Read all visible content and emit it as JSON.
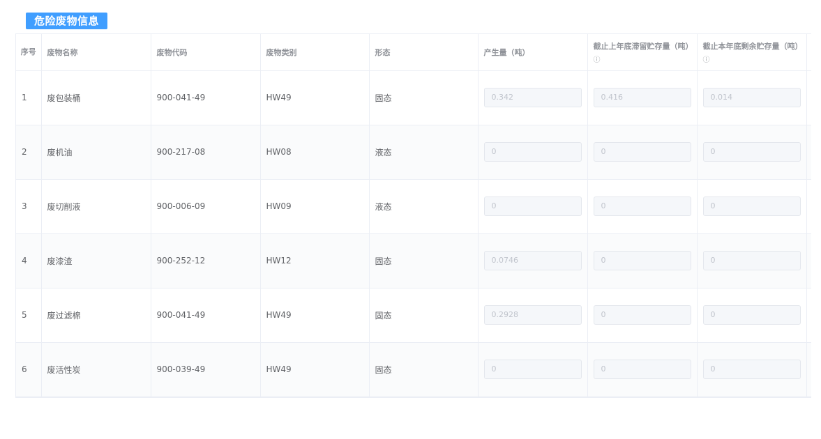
{
  "section": {
    "title": "危险废物信息"
  },
  "table": {
    "headers": {
      "no": "序号",
      "name": "废物名称",
      "code": "废物代码",
      "category": "废物类别",
      "form": "形态",
      "amount": "产生量（吨）",
      "prev_stock": "截止上年底滞留贮存量（吨）",
      "remain_stock": "截止本年底剩余贮存量（吨）",
      "info_icon": "ⓘ"
    },
    "rows": [
      {
        "no": "1",
        "name": "废包装桶",
        "code": "900-041-49",
        "category": "HW49",
        "form": "固态",
        "amount": "0.342",
        "prev_stock": "0.416",
        "remain_stock": "0.014"
      },
      {
        "no": "2",
        "name": "废机油",
        "code": "900-217-08",
        "category": "HW08",
        "form": "液态",
        "amount": "0",
        "prev_stock": "0",
        "remain_stock": "0"
      },
      {
        "no": "3",
        "name": "废切削液",
        "code": "900-006-09",
        "category": "HW09",
        "form": "液态",
        "amount": "0",
        "prev_stock": "0",
        "remain_stock": "0"
      },
      {
        "no": "4",
        "name": "废漆渣",
        "code": "900-252-12",
        "category": "HW12",
        "form": "固态",
        "amount": "0.0746",
        "prev_stock": "0",
        "remain_stock": "0"
      },
      {
        "no": "5",
        "name": "废过滤棉",
        "code": "900-041-49",
        "category": "HW49",
        "form": "固态",
        "amount": "0.2928",
        "prev_stock": "0",
        "remain_stock": "0"
      },
      {
        "no": "6",
        "name": "废活性炭",
        "code": "900-039-49",
        "category": "HW49",
        "form": "固态",
        "amount": "0",
        "prev_stock": "0",
        "remain_stock": "0"
      }
    ]
  },
  "colors": {
    "accent": "#409eff",
    "border": "#ebeef5",
    "text": "#606266",
    "header_text": "#909399",
    "input_bg": "#f5f7fa"
  }
}
